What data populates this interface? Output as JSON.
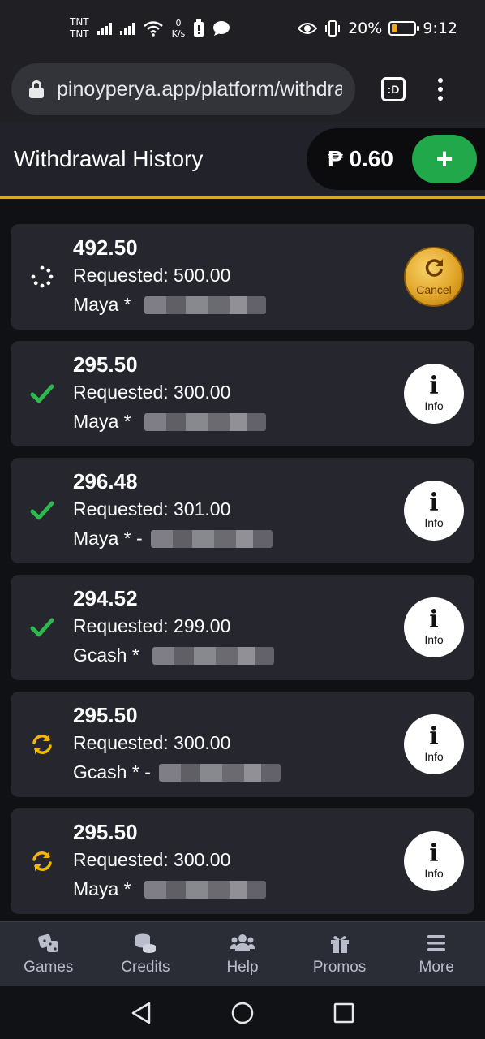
{
  "status_bar": {
    "carrier_1": "TNT",
    "carrier_2": "TNT",
    "net_speed_value": "0",
    "net_speed_unit": "K/s",
    "battery_percent": "20%",
    "battery_level": 0.2,
    "time": "9:12",
    "icons": [
      "signal-icon",
      "wifi-icon",
      "battery-alert-icon",
      "message-icon",
      "eye-icon",
      "vibrate-icon",
      "battery-icon"
    ]
  },
  "browser": {
    "url": "pinoyperya.app/platform/withdrawal-history",
    "tab_label": ":D"
  },
  "header": {
    "title": "Withdrawal History",
    "balance": "₱ 0.60",
    "add_label": "+"
  },
  "colors": {
    "accent_gold": "#d4a82a",
    "success_green": "#2fb84e",
    "pending_yellow": "#f2b705",
    "add_button_green": "#21a84a"
  },
  "withdrawals": [
    {
      "amount": "492.50",
      "requested": "Requested: 500.00",
      "method": "Maya * ",
      "status": "loading",
      "action_icon": "refresh-icon",
      "action_label": "Cancel"
    },
    {
      "amount": "295.50",
      "requested": "Requested: 300.00",
      "method": "Maya * ",
      "status": "completed",
      "action_icon": "info-icon",
      "action_label": "Info"
    },
    {
      "amount": "296.48",
      "requested": "Requested: 301.00",
      "method": "Maya * -",
      "status": "completed",
      "action_icon": "info-icon",
      "action_label": "Info"
    },
    {
      "amount": "294.52",
      "requested": "Requested: 299.00",
      "method": "Gcash * ",
      "status": "completed",
      "action_icon": "info-icon",
      "action_label": "Info"
    },
    {
      "amount": "295.50",
      "requested": "Requested: 300.00",
      "method": "Gcash * -",
      "status": "processing",
      "action_icon": "info-icon",
      "action_label": "Info"
    },
    {
      "amount": "295.50",
      "requested": "Requested: 300.00",
      "method": "Maya * ",
      "status": "processing",
      "action_icon": "info-icon",
      "action_label": "Info"
    }
  ],
  "bottom_nav": [
    {
      "label": "Games",
      "icon": "dice-icon"
    },
    {
      "label": "Credits",
      "icon": "coins-icon"
    },
    {
      "label": "Help",
      "icon": "users-icon"
    },
    {
      "label": "Promos",
      "icon": "gift-icon"
    },
    {
      "label": "More",
      "icon": "menu-icon"
    }
  ],
  "system_nav": [
    "back-icon",
    "home-icon",
    "recents-icon"
  ]
}
